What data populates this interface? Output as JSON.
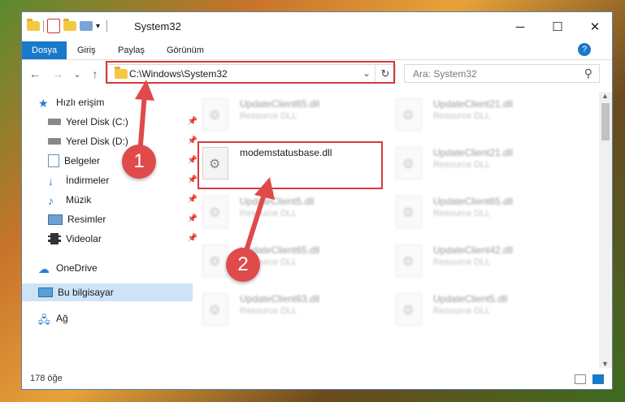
{
  "window": {
    "title": "System32",
    "minimize": "─",
    "maximize": "☐",
    "close": "✕"
  },
  "ribbon": {
    "tabs": [
      {
        "label": "Dosya",
        "active": true
      },
      {
        "label": "Giriş"
      },
      {
        "label": "Paylaş"
      },
      {
        "label": "Görünüm"
      }
    ],
    "help": "?"
  },
  "navigation": {
    "back": "←",
    "forward": "→",
    "recent": "⌄",
    "up": "↑",
    "address": "C:\\Windows\\System32",
    "address_dropdown": "⌄",
    "refresh": "↻",
    "search_placeholder": "Ara: System32",
    "search_icon": "⚲"
  },
  "sidebar": {
    "items": [
      {
        "label": "Hızlı erişim",
        "icon": "star-icon"
      },
      {
        "label": "Yerel Disk (C:)",
        "icon": "drive-icon",
        "pinned": true
      },
      {
        "label": "Yerel Disk (D:)",
        "icon": "drive-icon",
        "pinned": true
      },
      {
        "label": "Belgeler",
        "icon": "documents-icon",
        "pinned": true
      },
      {
        "label": "İndirmeler",
        "icon": "download-icon",
        "pinned": true
      },
      {
        "label": "Müzik",
        "icon": "music-icon",
        "pinned": true
      },
      {
        "label": "Resimler",
        "icon": "pictures-icon",
        "pinned": true
      },
      {
        "label": "Videolar",
        "icon": "videos-icon",
        "pinned": true
      },
      {
        "label": "OneDrive",
        "icon": "cloud-icon"
      },
      {
        "label": "Bu bilgisayar",
        "icon": "computer-icon",
        "selected": true
      },
      {
        "label": "Ağ",
        "icon": "network-icon"
      }
    ]
  },
  "files": [
    {
      "name": "UpdateClient65.dll",
      "type": "Resource DLL"
    },
    {
      "name": "UpdateClient21.dll",
      "type": "Resource DLL"
    },
    {
      "name": "modemstatusbase.dll",
      "type": "",
      "highlighted": true
    },
    {
      "name": "UpdateClient21.dll",
      "type": "Resource DLL"
    },
    {
      "name": "UpdateClient5.dll",
      "type": "Resource DLL"
    },
    {
      "name": "UpdateClient65.dll",
      "type": "Resource DLL"
    },
    {
      "name": "UpdateClient65.dll",
      "type": "Resource DLL"
    },
    {
      "name": "UpdateClient42.dll",
      "type": "Resource DLL"
    },
    {
      "name": "UpdateClient63.dll",
      "type": "Resource DLL"
    },
    {
      "name": "UpdateClient5.dll",
      "type": "Resource DLL"
    }
  ],
  "status": {
    "count": "178 öğe"
  },
  "annotations": {
    "step1": "1",
    "step2": "2",
    "color": "#e04a4a"
  }
}
